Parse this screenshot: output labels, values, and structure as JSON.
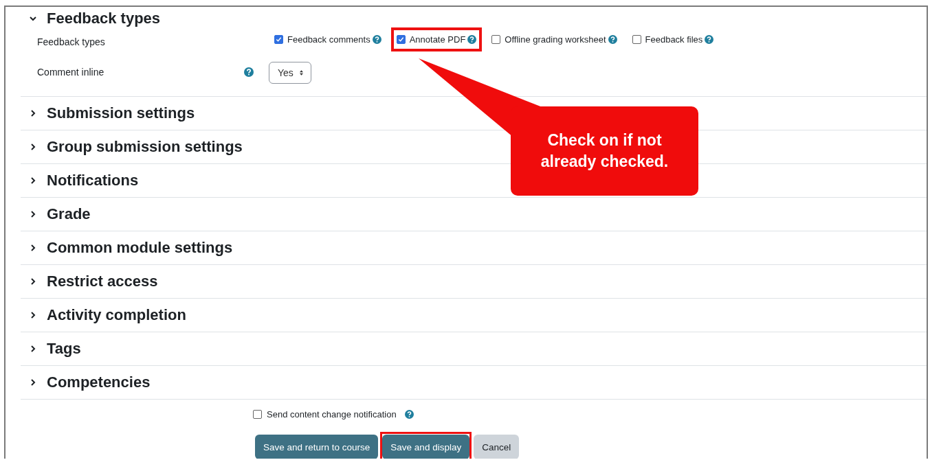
{
  "expanded_section": {
    "title": "Feedback types",
    "expanded": true,
    "fields": [
      {
        "kind": "checkboxes",
        "label": "Feedback types",
        "options": [
          {
            "label": "Feedback comments",
            "checked": true,
            "highlighted": false
          },
          {
            "label": "Annotate PDF",
            "checked": true,
            "highlighted": true
          },
          {
            "label": "Offline grading worksheet",
            "checked": false,
            "highlighted": false
          },
          {
            "label": "Feedback files",
            "checked": false,
            "highlighted": false
          }
        ]
      },
      {
        "kind": "select",
        "label": "Comment inline",
        "value": "Yes"
      }
    ]
  },
  "sections": [
    {
      "title": "Submission settings",
      "expanded": false
    },
    {
      "title": "Group submission settings",
      "expanded": false
    },
    {
      "title": "Notifications",
      "expanded": false
    },
    {
      "title": "Grade",
      "expanded": false
    },
    {
      "title": "Common module settings",
      "expanded": false
    },
    {
      "title": "Restrict access",
      "expanded": false
    },
    {
      "title": "Activity completion",
      "expanded": false
    },
    {
      "title": "Tags",
      "expanded": false
    },
    {
      "title": "Competencies",
      "expanded": false
    }
  ],
  "notify": {
    "label": "Send content change notification",
    "checked": false
  },
  "buttons": [
    {
      "label": "Save and return to course",
      "kind": "primary",
      "highlighted": false
    },
    {
      "label": "Save and display",
      "kind": "primary",
      "highlighted": true
    },
    {
      "label": "Cancel",
      "kind": "secondary",
      "highlighted": false
    }
  ],
  "callout": {
    "text": "Check on if not already checked."
  }
}
